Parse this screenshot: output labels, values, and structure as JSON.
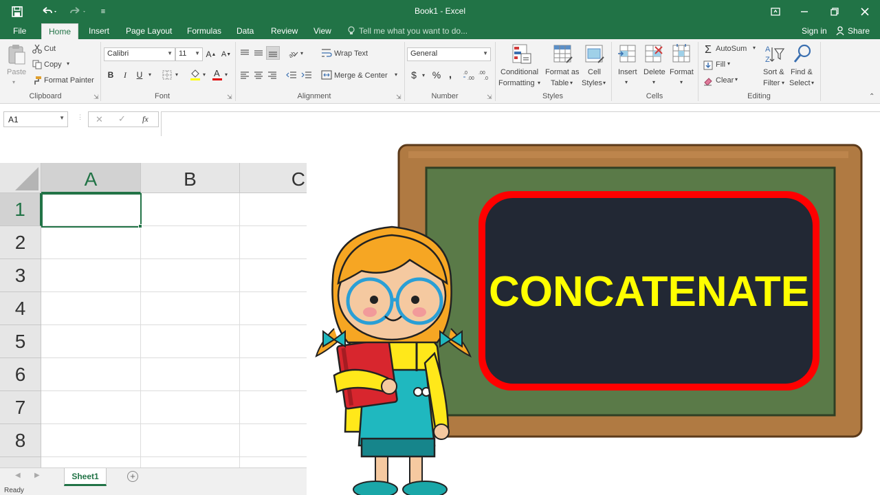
{
  "window": {
    "title": "Book1 - Excel"
  },
  "tabs": [
    "File",
    "Home",
    "Insert",
    "Page Layout",
    "Formulas",
    "Data",
    "Review",
    "View"
  ],
  "active_tab": "Home",
  "tellme_placeholder": "Tell me what you want to do...",
  "account": {
    "signin": "Sign in",
    "share": "Share"
  },
  "clipboard": {
    "paste": "Paste",
    "cut": "Cut",
    "copy": "Copy",
    "format_painter": "Format Painter",
    "group": "Clipboard"
  },
  "font": {
    "name": "Calibri",
    "size": "11",
    "bold": "B",
    "italic": "I",
    "underline": "U",
    "group": "Font"
  },
  "alignment": {
    "wrap_text": "Wrap Text",
    "merge_center": "Merge & Center",
    "group": "Alignment"
  },
  "number": {
    "format": "General",
    "currency": "$",
    "percent": "%",
    "comma": ",",
    "group": "Number"
  },
  "styles": {
    "conditional1": "Conditional",
    "conditional2": "Formatting",
    "format_table1": "Format as",
    "format_table2": "Table",
    "cell_styles1": "Cell",
    "cell_styles2": "Styles",
    "group": "Styles"
  },
  "cells": {
    "insert": "Insert",
    "delete": "Delete",
    "format": "Format",
    "group": "Cells"
  },
  "editing": {
    "autosum": "AutoSum",
    "fill": "Fill",
    "clear": "Clear",
    "sort1": "Sort &",
    "sort2": "Filter",
    "find1": "Find &",
    "find2": "Select",
    "group": "Editing"
  },
  "formula_bar": {
    "name_box": "A1",
    "fx": "fx",
    "value": ""
  },
  "grid": {
    "columns": [
      "A",
      "B",
      "C"
    ],
    "rows": [
      "1",
      "2",
      "3",
      "4",
      "5",
      "6",
      "7",
      "8"
    ],
    "active_cell": "A1"
  },
  "sheet_tab": "Sheet1",
  "status": "Ready",
  "board": {
    "text": "CONCATENATE"
  },
  "colors": {
    "excel_green": "#217346",
    "board_text": "#ffff00",
    "board_frame": "#ff0000",
    "board_bg": "#222834"
  }
}
